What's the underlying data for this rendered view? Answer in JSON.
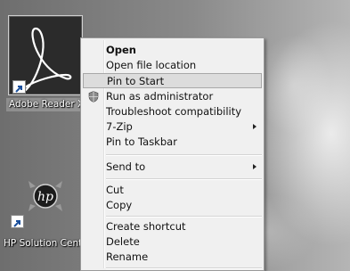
{
  "desktop": {
    "icons": [
      {
        "label": "Adobe Reader XI",
        "icon": "adobe-reader-icon"
      },
      {
        "label": "HP Solution Center",
        "icon": "hp-logo-icon"
      }
    ]
  },
  "context_menu": {
    "items": [
      {
        "label": "Open",
        "bold": true
      },
      {
        "label": "Open file location"
      },
      {
        "label": "Pin to Start",
        "highlighted": true
      },
      {
        "label": "Run as administrator",
        "icon": "uac-shield-icon"
      },
      {
        "label": "Troubleshoot compatibility"
      },
      {
        "label": "7-Zip",
        "submenu": true
      },
      {
        "label": "Pin to Taskbar"
      },
      {
        "label": "Send to",
        "submenu": true
      },
      {
        "label": "Cut"
      },
      {
        "label": "Copy"
      },
      {
        "label": "Create shortcut"
      },
      {
        "label": "Delete"
      },
      {
        "label": "Rename"
      }
    ]
  }
}
